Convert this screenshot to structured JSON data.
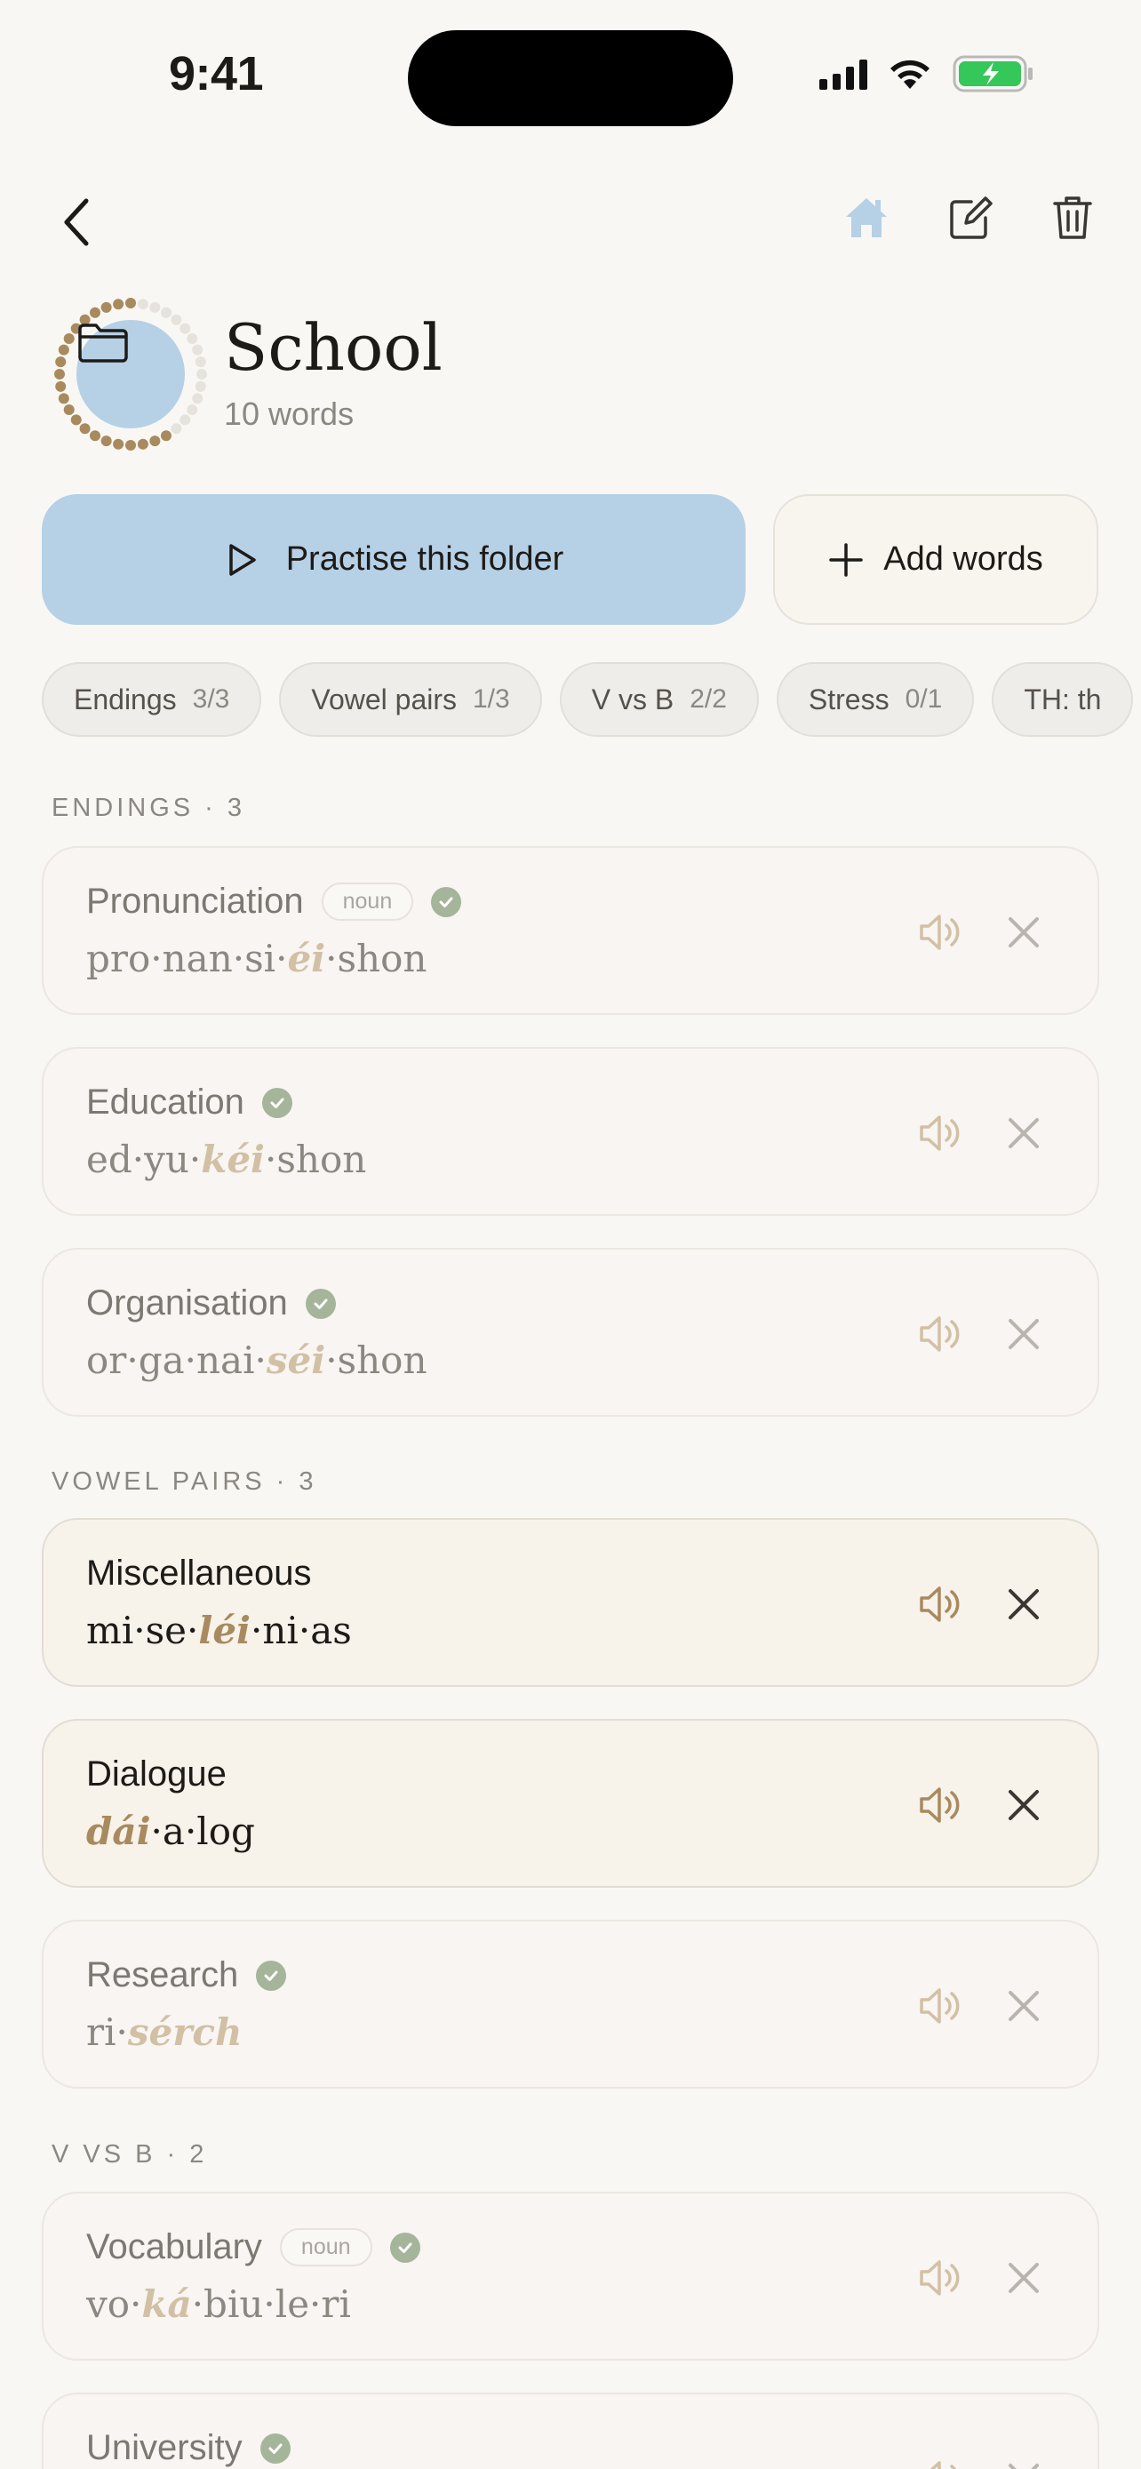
{
  "status": {
    "time": "9:41"
  },
  "folder": {
    "name": "School",
    "word_count": "10 words",
    "progress": 0.6
  },
  "actions": {
    "practise_label": "Practise this folder",
    "add_label": "Add words"
  },
  "chips": [
    {
      "label": "Endings",
      "count": "3/3"
    },
    {
      "label": "Vowel pairs",
      "count": "1/3"
    },
    {
      "label": "V vs B",
      "count": "2/2"
    },
    {
      "label": "Stress",
      "count": "0/1"
    },
    {
      "label": "TH: th",
      "count": ""
    }
  ],
  "sections": [
    {
      "label": "ENDINGS · 3"
    },
    {
      "label": "VOWEL PAIRS · 3"
    },
    {
      "label": "V VS B · 2"
    }
  ],
  "words": [
    {
      "word": "Pronunciation",
      "tag": "noun",
      "mastered": true,
      "pre": "pro·nan·si·",
      "stress": "éi",
      "post": "·shon"
    },
    {
      "word": "Education",
      "tag": "",
      "mastered": true,
      "pre": "ed·yu·",
      "stress": "kéi",
      "post": "·shon"
    },
    {
      "word": "Organisation",
      "tag": "",
      "mastered": true,
      "pre": "or·ga·nai·",
      "stress": "séi",
      "post": "·shon"
    },
    {
      "word": "Miscellaneous",
      "tag": "",
      "mastered": false,
      "pre": "mi·se·",
      "stress": "léi",
      "post": "·ni·as"
    },
    {
      "word": "Dialogue",
      "tag": "",
      "mastered": false,
      "pre": "",
      "stress": "dái",
      "post": "·a·log"
    },
    {
      "word": "Research",
      "tag": "",
      "mastered": true,
      "pre": "ri·",
      "stress": "sérch",
      "post": ""
    },
    {
      "word": "Vocabulary",
      "tag": "noun",
      "mastered": true,
      "pre": "vo·",
      "stress": "ká",
      "post": "·biu·le·ri"
    },
    {
      "word": "University",
      "tag": "",
      "mastered": true,
      "pre": "",
      "stress": "",
      "post": ""
    }
  ]
}
